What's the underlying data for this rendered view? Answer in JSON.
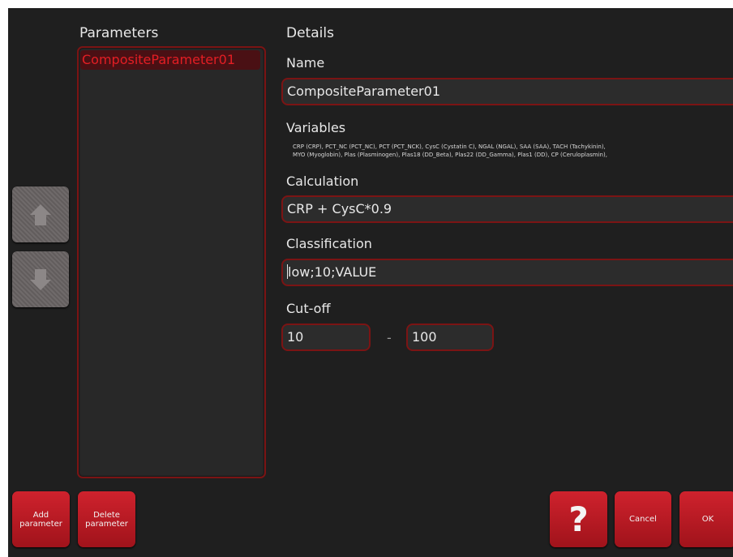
{
  "parameters": {
    "title": "Parameters",
    "items": [
      "CompositeParameter01"
    ]
  },
  "details": {
    "title": "Details",
    "name_label": "Name",
    "name_value": "CompositeParameter01",
    "variables_label": "Variables",
    "variables_line1": "CRP (CRP), PCT_NC (PCT_NC), PCT (PCT_NCK), CysC (Cystatin C), NGAL (NGAL), SAA (SAA), TACH (Tachykinin),",
    "variables_line2": "MYO (Myoglobin), Plas (Plasminogen), Plas18 (DD_Beta), Plas22 (DD_Gamma), Plas1 (DD), CP (Ceruloplasmin),",
    "calculation_label": "Calculation",
    "calculation_value": "CRP + CysC*0.9",
    "classification_label": "Classification",
    "classification_value": "low;10;VALUE",
    "cutoff_label": "Cut-off",
    "cutoff_min": "10",
    "cutoff_separator": "-",
    "cutoff_max": "100"
  },
  "buttons": {
    "add_line1": "Add",
    "add_line2": "parameter",
    "delete_line1": "Delete",
    "delete_line2": "parameter",
    "help": "?",
    "cancel": "Cancel",
    "ok": "OK"
  },
  "icons": {
    "move_up": "arrow-up-icon",
    "move_down": "arrow-down-icon"
  },
  "colors": {
    "background": "#1f1f1f",
    "accent": "#c91f2b",
    "border": "#7b1414",
    "selected_text": "#e31e24",
    "disabled_button": "#6a6565"
  }
}
